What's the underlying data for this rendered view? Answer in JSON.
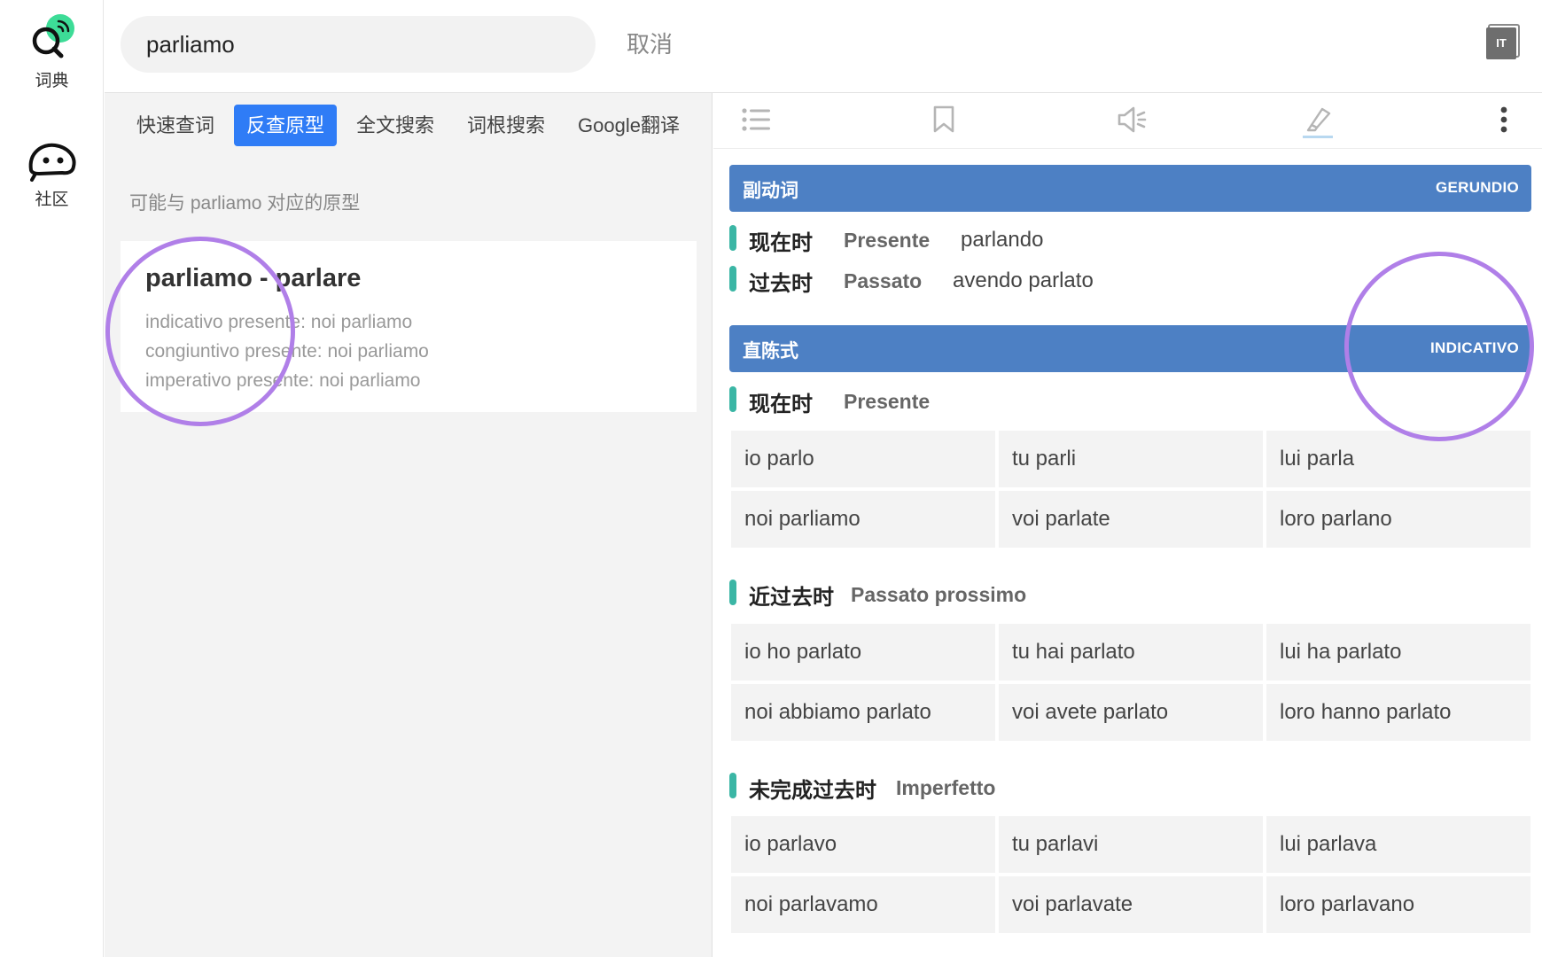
{
  "sidebar": {
    "items": [
      {
        "label": "词典",
        "icon": "dictionary-icon"
      },
      {
        "label": "社区",
        "icon": "community-icon"
      }
    ]
  },
  "header": {
    "search_value": "parliamo",
    "cancel_label": "取消",
    "language_badge": "IT"
  },
  "left": {
    "tabs": [
      {
        "label": "快速查词",
        "active": false
      },
      {
        "label": "反查原型",
        "active": true
      },
      {
        "label": "全文搜索",
        "active": false
      },
      {
        "label": "词根搜索",
        "active": false
      },
      {
        "label": "Google翻译",
        "active": false
      }
    ],
    "hint": "可能与 parliamo 对应的原型",
    "result": {
      "title": "parliamo - parlare",
      "lines": [
        "indicativo presente: noi parliamo",
        "congiuntivo presente: noi parliamo",
        "imperativo presente: noi parliamo"
      ]
    }
  },
  "right": {
    "toolbar_icons": [
      "list-icon",
      "bookmark-icon",
      "speaker-icon",
      "highlighter-icon",
      "more-icon"
    ],
    "gerundio": {
      "zh": "副动词",
      "it": "GERUNDIO",
      "rows": [
        {
          "zh": "现在时",
          "it": "Presente",
          "value": "parlando"
        },
        {
          "zh": "过去时",
          "it": "Passato",
          "value": "avendo parlato"
        }
      ]
    },
    "indicativo": {
      "zh": "直陈式",
      "it": "INDICATIVO",
      "tenses": [
        {
          "zh": "现在时",
          "it": "Presente",
          "forms": [
            "io parlo",
            "tu parli",
            "lui parla",
            "noi parliamo",
            "voi parlate",
            "loro parlano"
          ]
        },
        {
          "zh": "近过去时",
          "it": "Passato prossimo",
          "forms": [
            "io ho parlato",
            "tu hai parlato",
            "lui ha parlato",
            "noi abbiamo parlato",
            "voi avete parlato",
            "loro hanno parlato"
          ]
        },
        {
          "zh": "未完成过去时",
          "it": "Imperfetto",
          "forms": [
            "io parlavo",
            "tu parlavi",
            "lui parlava",
            "noi parlavamo",
            "voi parlavate",
            "loro parlavano"
          ]
        }
      ]
    }
  },
  "colors": {
    "accent_blue": "#2f7cf6",
    "section_blue": "#4d80c4",
    "tense_marker": "#3bb6a5",
    "highlight_ring": "#b07fe8",
    "logo_green": "#3ddc97"
  }
}
